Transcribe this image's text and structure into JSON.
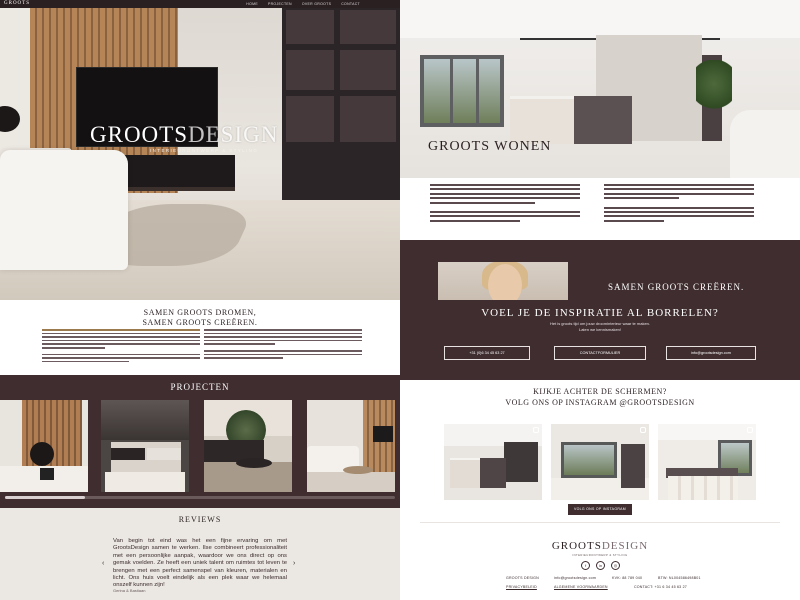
{
  "hero": {
    "logo_small": "GROOTS",
    "nav": [
      "HOME",
      "PROJECTEN",
      "OVER GROOTS",
      "CONTACT"
    ],
    "brand_main": "GROOTS",
    "brand_thin": "DESIGN",
    "tagline": "INTERIEURONTWERP & STYLING"
  },
  "wonen": {
    "title": "GROOTS WONEN"
  },
  "team": {
    "title": "SAMEN GROOTS CREËREN."
  },
  "samen": {
    "title_line1": "SAMEN GROOTS DROMEN,",
    "title_line2": "SAMEN GROOTS CREËREN."
  },
  "inspiratie": {
    "title": "VOEL JE DE INSPIRATIE AL BORRELEN?",
    "sub_line1": "Het is groots tijd om jouw droominterieur waar te maken.",
    "sub_line2": "Laten we kennismaken!",
    "buttons": [
      {
        "label": "+31 (0)6 34 45 63 27"
      },
      {
        "label": "CONTACTFORMULIER"
      },
      {
        "label": "info@grootsdesign.com"
      }
    ]
  },
  "projecten": {
    "title": "PROJECTEN"
  },
  "instagram": {
    "title_line1": "KIJKJE ACHTER DE SCHERMEN?",
    "title_line2": "VOLG ONS OP INSTAGRAM @GROOTSDESIGN",
    "button": "VOLG ONS OP INSTAGRAM"
  },
  "footer": {
    "logo_main": "GROOTS",
    "logo_thin": "DESIGN",
    "logo_sub": "INTERIEURONTWERP & STYLING",
    "social": [
      {
        "icon": "facebook-icon",
        "glyph": "f"
      },
      {
        "icon": "linkedin-icon",
        "glyph": "in"
      },
      {
        "icon": "instagram-icon",
        "glyph": "◎"
      }
    ],
    "row1": [
      "GROOTS DESIGN",
      "info@grootsdesign.com",
      "KVK: 88 789 040",
      "BTW: NL004586498B01"
    ],
    "row2": [
      "PRIVACYBELEID",
      "ALGEMENE VOORWAARDEN",
      "CONTACT: +31 6 34 45 63 27"
    ]
  },
  "reviews": {
    "title": "REVIEWS",
    "text": "Van begin tot eind was het een fijne ervaring om met GrootsDesign samen te werken. Ilse combineert professionaliteit met een persoonlijke aanpak, waardoor we ons direct op ons gemak voelden. Ze heeft een uniek talent om ruimtes tot leven te brengen met een perfect samenspel van kleuren, materialen en licht. Ons huis voelt eindelijk als een plek waar we helemaal onszelf kunnen zijn!",
    "author": "Gerina & Bastiaan",
    "prev": "‹",
    "next": "›"
  },
  "colors": {
    "brand_dark": "#3f2d30",
    "light_bg": "#ebe8e3",
    "white": "#ffffff"
  }
}
